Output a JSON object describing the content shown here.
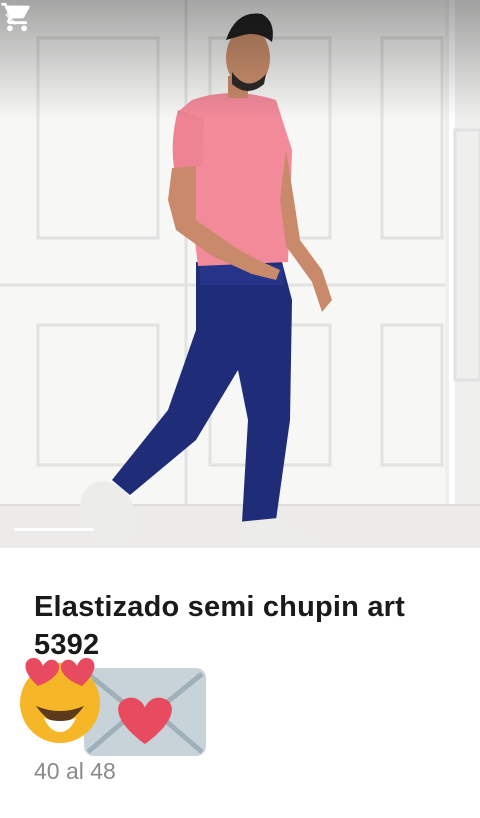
{
  "header": {
    "back_icon": "arrow-left-icon",
    "cart_icon": "shopping-cart-icon"
  },
  "gallery": {
    "image": "man-in-pink-tshirt-and-blue-jeans",
    "slide_count": 1,
    "active_slide": 0
  },
  "product": {
    "title": "Elastizado semi chupin art 5392",
    "emoji": [
      "smiling-face-with-heart-eyes",
      "envelope-with-heart"
    ],
    "sizes": "40 al 48"
  },
  "colors": {
    "shirt": "#f38a9a",
    "jeans": "#1f2d78",
    "title_text": "#1a1a1a",
    "subtitle_text": "#8a8a8a"
  }
}
